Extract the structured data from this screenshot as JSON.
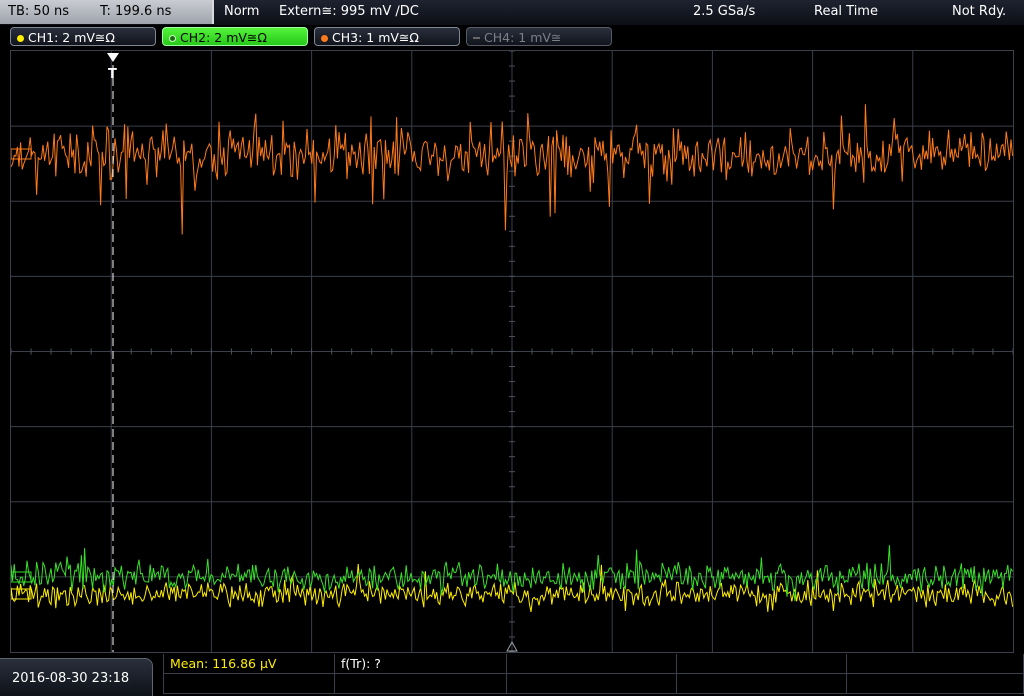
{
  "topbar": {
    "timebase": "TB: 50 ns",
    "trigger_time": "T: 199.6 ns",
    "trigger_mode": "Norm",
    "trigger_source": "Extern≅: 995 mV ∕DC",
    "sample_rate": "2.5 GSa/s",
    "acq_mode": "Real Time",
    "status": "Not Rdy."
  },
  "channels": [
    {
      "label": "CH1: 2 mV≅Ω",
      "color": "#ffee00",
      "state": "normal"
    },
    {
      "label": "CH2: 2 mV≅Ω",
      "color": "#39e02a",
      "state": "active"
    },
    {
      "label": "CH3: 1 mV≅Ω",
      "color": "#ff7a1a",
      "state": "normal"
    },
    {
      "label": "CH4: 1 mV≅",
      "color": "#777777",
      "state": "inactive"
    }
  ],
  "bottom": {
    "datetime": "2016-08-30 23:18",
    "measurement_1": "Mean: 116.86 µV",
    "measurement_2": "f(Tr): ?"
  },
  "colors": {
    "ch1": "#ffee00",
    "ch2": "#39e02a",
    "ch3": "#ff7a1a",
    "grid": "#3a3f49",
    "measure_text": "#ffee00"
  }
}
